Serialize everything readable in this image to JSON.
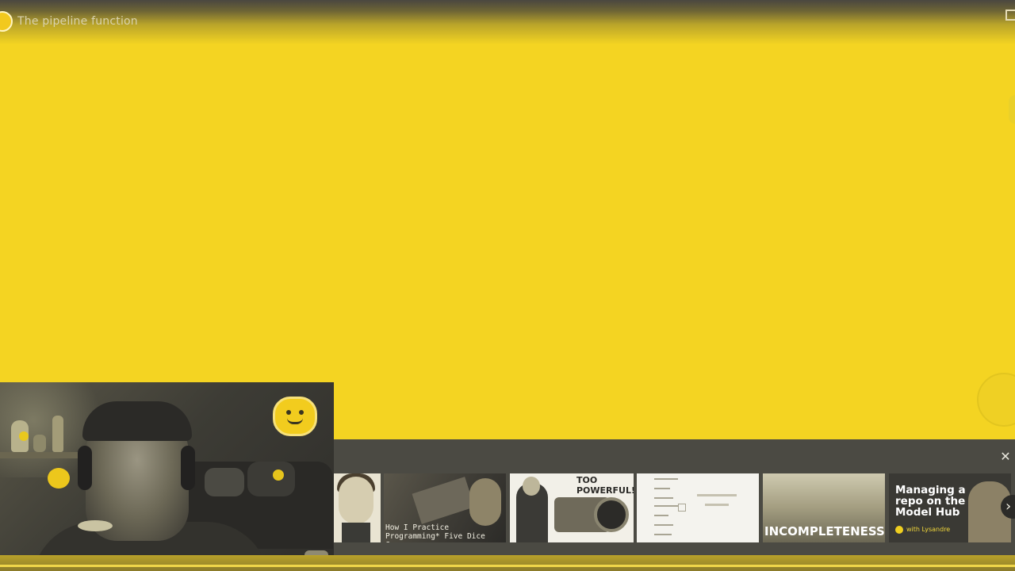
{
  "player": {
    "video_title": "The pipeline function",
    "channel_logo_icon": "huggingface-logo-icon",
    "watch_later_icon": "watch-later-icon",
    "progress_fraction": 1.0
  },
  "related": {
    "close_icon": "close-icon",
    "next_icon": "chevron-right-icon",
    "items": [
      {
        "caption": ""
      },
      {
        "caption": "How I Practice Programming* Five Dice Games"
      },
      {
        "caption": "TOO POWERFUL!"
      },
      {
        "caption": ""
      },
      {
        "caption": "INCOMPLETENESS"
      },
      {
        "caption": "Managing a repo on the Model Hub",
        "sub": "with Lysandre"
      }
    ]
  },
  "colors": {
    "background": "#f4d422",
    "strip": "#4b4a43",
    "accent": "#f2cc1e"
  }
}
